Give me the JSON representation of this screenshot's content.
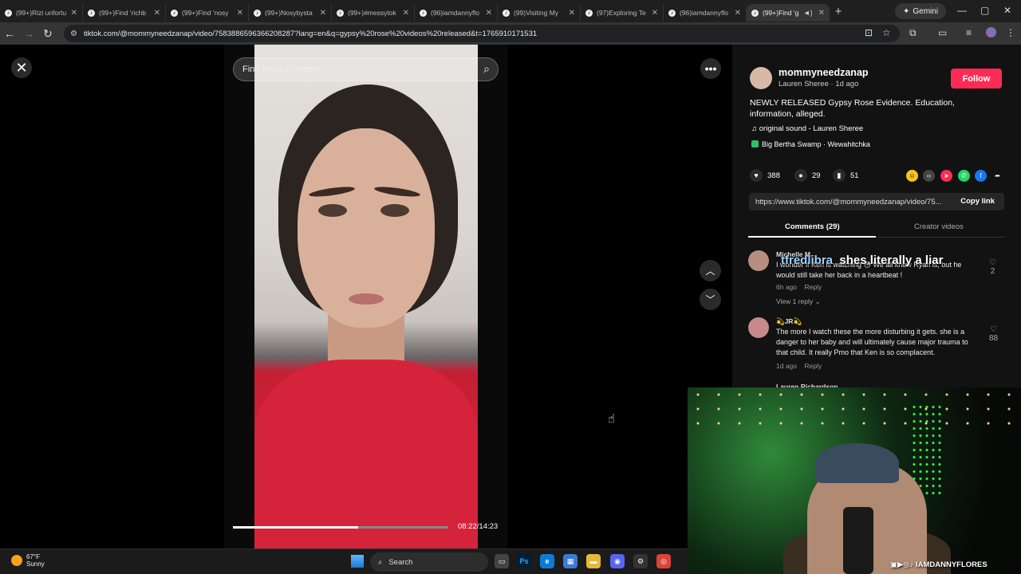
{
  "browser": {
    "tabs": [
      {
        "title": "(99+)Rizi unfortu",
        "active": false
      },
      {
        "title": "(99+)Find 'richb",
        "active": false
      },
      {
        "title": "(99+)Find 'nosy",
        "active": false
      },
      {
        "title": "(99+)Nosybysta",
        "active": false
      },
      {
        "title": "(99+)#messytok",
        "active": false
      },
      {
        "title": "(96)iamdannyflo",
        "active": false
      },
      {
        "title": "(99)Visiting My",
        "active": false
      },
      {
        "title": "(97)Exploring Te",
        "active": false
      },
      {
        "title": "(96)iamdannyflo",
        "active": false
      },
      {
        "title": "(99+)Find 'g",
        "active": true
      }
    ],
    "gemini_label": "Gemini",
    "url": "tiktok.com/@mommyneedzanap/video/7583886596366208287?lang=en&q=gypsy%20rose%20videos%20released&t=1765910171531"
  },
  "video": {
    "search_placeholder": "Find related content",
    "time": "08:22/14:23",
    "progress": 0.58
  },
  "panel": {
    "username": "mommyneedzanap",
    "subline": "Lauren Sheree · 1d ago",
    "follow_label": "Follow",
    "description": "NEWLY RELEASED Gypsy Rose Evidence. Education, information, alleged.",
    "sound": "original sound - Lauren Sheree",
    "location": "Big Bertha Swamp · Wewahitchka",
    "likes": "388",
    "comments_count": "29",
    "saves": "51",
    "link": "https://www.tiktok.com/@mommyneedzanap/video/75...",
    "copy_label": "Copy link",
    "tab_comments": "Comments (29)",
    "tab_creator": "Creator videos",
    "comments": [
      {
        "user": "Michelle M.",
        "text": "I wonder if Ken is watching 😳 We all knew Ryan is, but he would still take her back in a heartbeat !",
        "time": "6h ago",
        "reply": "Reply",
        "likes": "2",
        "view_replies": "View 1 reply ⌄"
      },
      {
        "user": "💫JR💫",
        "text": "The more I watch these the more disturbing it gets. she is a danger to her baby and will ultimately cause major trauma to that child. It really Pmo that Ken is so complacent.",
        "time": "1d ago",
        "reply": "Reply",
        "likes": "88"
      }
    ],
    "partial_next_user": "Lauren Richardson"
  },
  "overlay": {
    "user": "tfredlibra",
    "text": "shes literally a liar"
  },
  "stream": {
    "handle": "IAMDANNYFLORES"
  },
  "taskbar": {
    "temp": "67°F",
    "condition": "Sunny",
    "search_label": "Search"
  },
  "colors": {
    "follow": "#fe2c55",
    "panel_bg": "#121212",
    "stage_bg": "#000000",
    "browser_chrome": "#1f1f1f"
  }
}
